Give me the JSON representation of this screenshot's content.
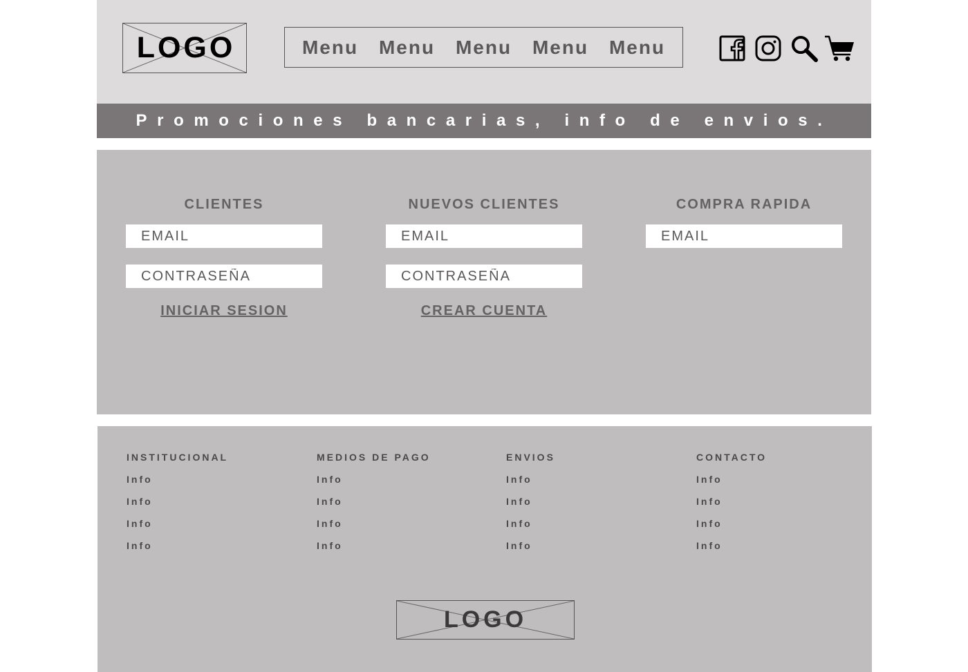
{
  "header": {
    "logo_text": "LOGO",
    "menu": [
      "Menu",
      "Menu",
      "Menu",
      "Menu",
      "Menu"
    ],
    "icons": [
      "facebook-icon",
      "instagram-icon",
      "search-icon",
      "cart-icon"
    ]
  },
  "promo": {
    "text": "Promociones bancarias, info de envios."
  },
  "login": {
    "clientes": {
      "title": "CLIENTES",
      "email_placeholder": "EMAIL",
      "password_placeholder": "CONTRASEÑA",
      "action": "INICIAR SESION"
    },
    "nuevos": {
      "title": "NUEVOS CLIENTES",
      "email_placeholder": "EMAIL",
      "password_placeholder": "CONTRASEÑA",
      "action": "CREAR CUENTA"
    },
    "rapida": {
      "title": "COMPRA RAPIDA",
      "email_placeholder": "EMAIL"
    }
  },
  "footer": {
    "columns": [
      {
        "title": "INSTITUCIONAL",
        "items": [
          "Info",
          "Info",
          "Info",
          "Info"
        ]
      },
      {
        "title": "MEDIOS DE PAGO",
        "items": [
          "Info",
          "Info",
          "Info",
          "Info"
        ]
      },
      {
        "title": "ENVIOS",
        "items": [
          "Info",
          "Info",
          "Info",
          "Info"
        ]
      },
      {
        "title": "CONTACTO",
        "items": [
          "Info",
          "Info",
          "Info",
          "Info"
        ]
      }
    ],
    "logo_text": "LOGO"
  },
  "colors": {
    "header_bg": "#dddbdc",
    "promo_bg": "#7a7677",
    "section_bg": "#bfbdbe"
  }
}
